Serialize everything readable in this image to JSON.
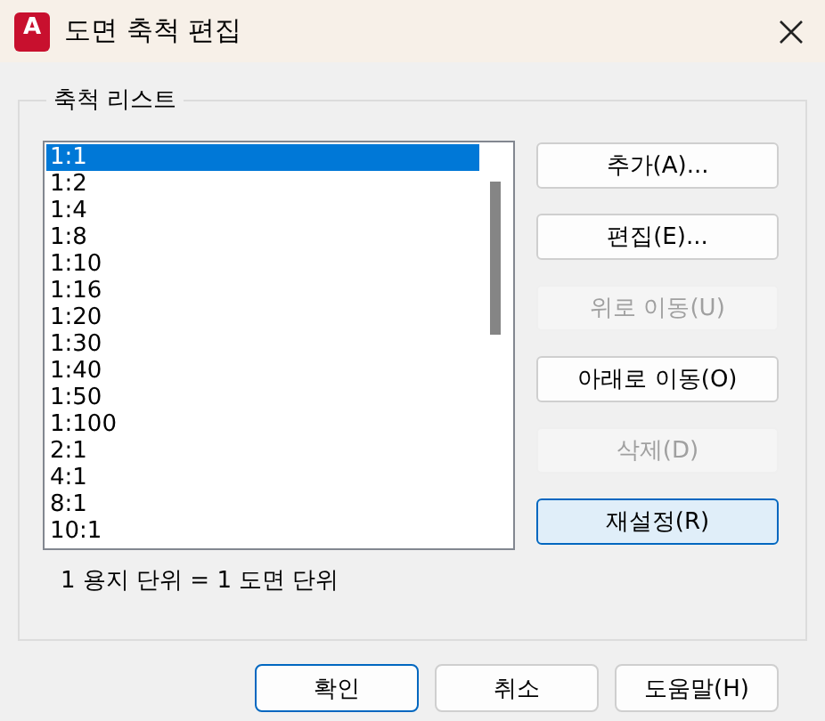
{
  "window": {
    "title": "도면 축척 편집",
    "logo_text": "A"
  },
  "scale_group": {
    "title": "축척 리스트",
    "items": [
      {
        "label": "1:1",
        "selected": true
      },
      {
        "label": "1:2",
        "selected": false
      },
      {
        "label": "1:4",
        "selected": false
      },
      {
        "label": "1:8",
        "selected": false
      },
      {
        "label": "1:10",
        "selected": false
      },
      {
        "label": "1:16",
        "selected": false
      },
      {
        "label": "1:20",
        "selected": false
      },
      {
        "label": "1:30",
        "selected": false
      },
      {
        "label": "1:40",
        "selected": false
      },
      {
        "label": "1:50",
        "selected": false
      },
      {
        "label": "1:100",
        "selected": false
      },
      {
        "label": "2:1",
        "selected": false
      },
      {
        "label": "4:1",
        "selected": false
      },
      {
        "label": "8:1",
        "selected": false
      },
      {
        "label": "10:1",
        "selected": false
      }
    ],
    "buttons": [
      {
        "label": "추가(A)...",
        "disabled": false,
        "focused": false
      },
      {
        "label": "편집(E)...",
        "disabled": false,
        "focused": false
      },
      {
        "label": "위로 이동(U)",
        "disabled": true,
        "focused": false
      },
      {
        "label": "아래로 이동(O)",
        "disabled": false,
        "focused": false
      },
      {
        "label": "삭제(D)",
        "disabled": true,
        "focused": false
      },
      {
        "label": "재설정(R)",
        "disabled": false,
        "focused": true
      }
    ],
    "unit_text": "1 용지 단위 = 1 도면 단위"
  },
  "footer_buttons": [
    {
      "label": "확인",
      "default": true
    },
    {
      "label": "취소",
      "default": false
    },
    {
      "label": "도움말(H)",
      "default": false
    }
  ]
}
